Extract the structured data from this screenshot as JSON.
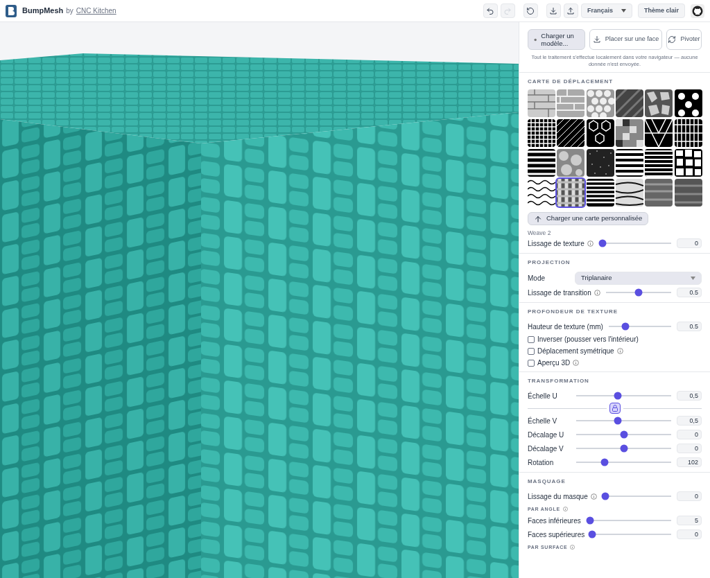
{
  "header": {
    "app_name": "BumpMesh",
    "by": "by",
    "author_link": "CNC Kitchen",
    "language": "Français",
    "theme_button": "Thème clair",
    "redo_disabled": true
  },
  "panel": {
    "actions": [
      {
        "kind": "primary",
        "label": "Charger un modèle..."
      },
      {
        "kind": "download",
        "label": "Placer sur une face"
      },
      {
        "kind": "rotate",
        "label": "Pivoter"
      }
    ],
    "privacy_note": "Tout le traitement s'effectue localement dans votre navigateur — aucune donnée n'est envoyée.",
    "displacement_map": {
      "title": "CARTE DE DÉPLACEMENT",
      "thumbnails": [
        {
          "selected": false
        },
        {
          "selected": false
        },
        {
          "selected": false
        },
        {
          "selected": false
        },
        {
          "selected": false
        },
        {
          "selected": false
        },
        {
          "selected": false
        },
        {
          "selected": false
        },
        {
          "selected": false
        },
        {
          "selected": false
        },
        {
          "selected": false
        },
        {
          "selected": false
        },
        {
          "selected": false
        },
        {
          "selected": false
        },
        {
          "selected": false
        },
        {
          "selected": false
        },
        {
          "selected": false
        },
        {
          "selected": false
        },
        {
          "selected": false
        },
        {
          "selected": true
        },
        {
          "selected": false
        },
        {
          "selected": false
        },
        {
          "selected": false
        },
        {
          "selected": false
        }
      ],
      "upload_button": "Charger une carte personnalisée",
      "selected_name": "Weave 2",
      "slider": {
        "label": "Lissage de texture",
        "info": true,
        "level": 0.05,
        "value": "0"
      }
    },
    "projection": {
      "title": "PROJECTION",
      "mode_label": "Mode",
      "mode_value": "Triplanaire",
      "slider": {
        "label": "Lissage de transition",
        "info": true,
        "level": 0.5,
        "value": "0.5"
      }
    },
    "depth": {
      "title": "PROFONDEUR DE TEXTURE",
      "slider": {
        "label": "Hauteur de texture (mm)",
        "level": 0.27,
        "value": "0.5"
      },
      "checkboxes": [
        {
          "label": "Inverser (pousser vers l'intérieur)",
          "checked": false
        },
        {
          "label": "Déplacement symétrique",
          "info": true,
          "checked": false
        },
        {
          "label": "Aperçu 3D",
          "info": true,
          "checked": false
        }
      ]
    },
    "transformation": {
      "title": "TRANSFORMATION",
      "sliders": [
        {
          "label": "Échelle U",
          "level": 0.44,
          "value": "0,5"
        },
        {
          "label": "Échelle V",
          "level": 0.44,
          "value": "0,5"
        },
        {
          "label": "Décalage U",
          "level": 0.5,
          "value": "0"
        },
        {
          "label": "Décalage V",
          "level": 0.5,
          "value": "0"
        },
        {
          "label": "Rotation",
          "level": 0.3,
          "value": "102"
        }
      ],
      "scale_locked": true
    },
    "masking": {
      "title": "MASQUAGE",
      "slider": {
        "label": "Lissage du masque",
        "info": true,
        "level": 0.04,
        "value": "0"
      },
      "by_angle": "PAR ANGLE",
      "sliders": [
        {
          "label": "Faces inférieures",
          "level": 0.04,
          "value": "5"
        },
        {
          "label": "Faces supérieures",
          "level": 0.02,
          "value": "0"
        }
      ],
      "by_surface": "PAR SURFACE"
    }
  }
}
